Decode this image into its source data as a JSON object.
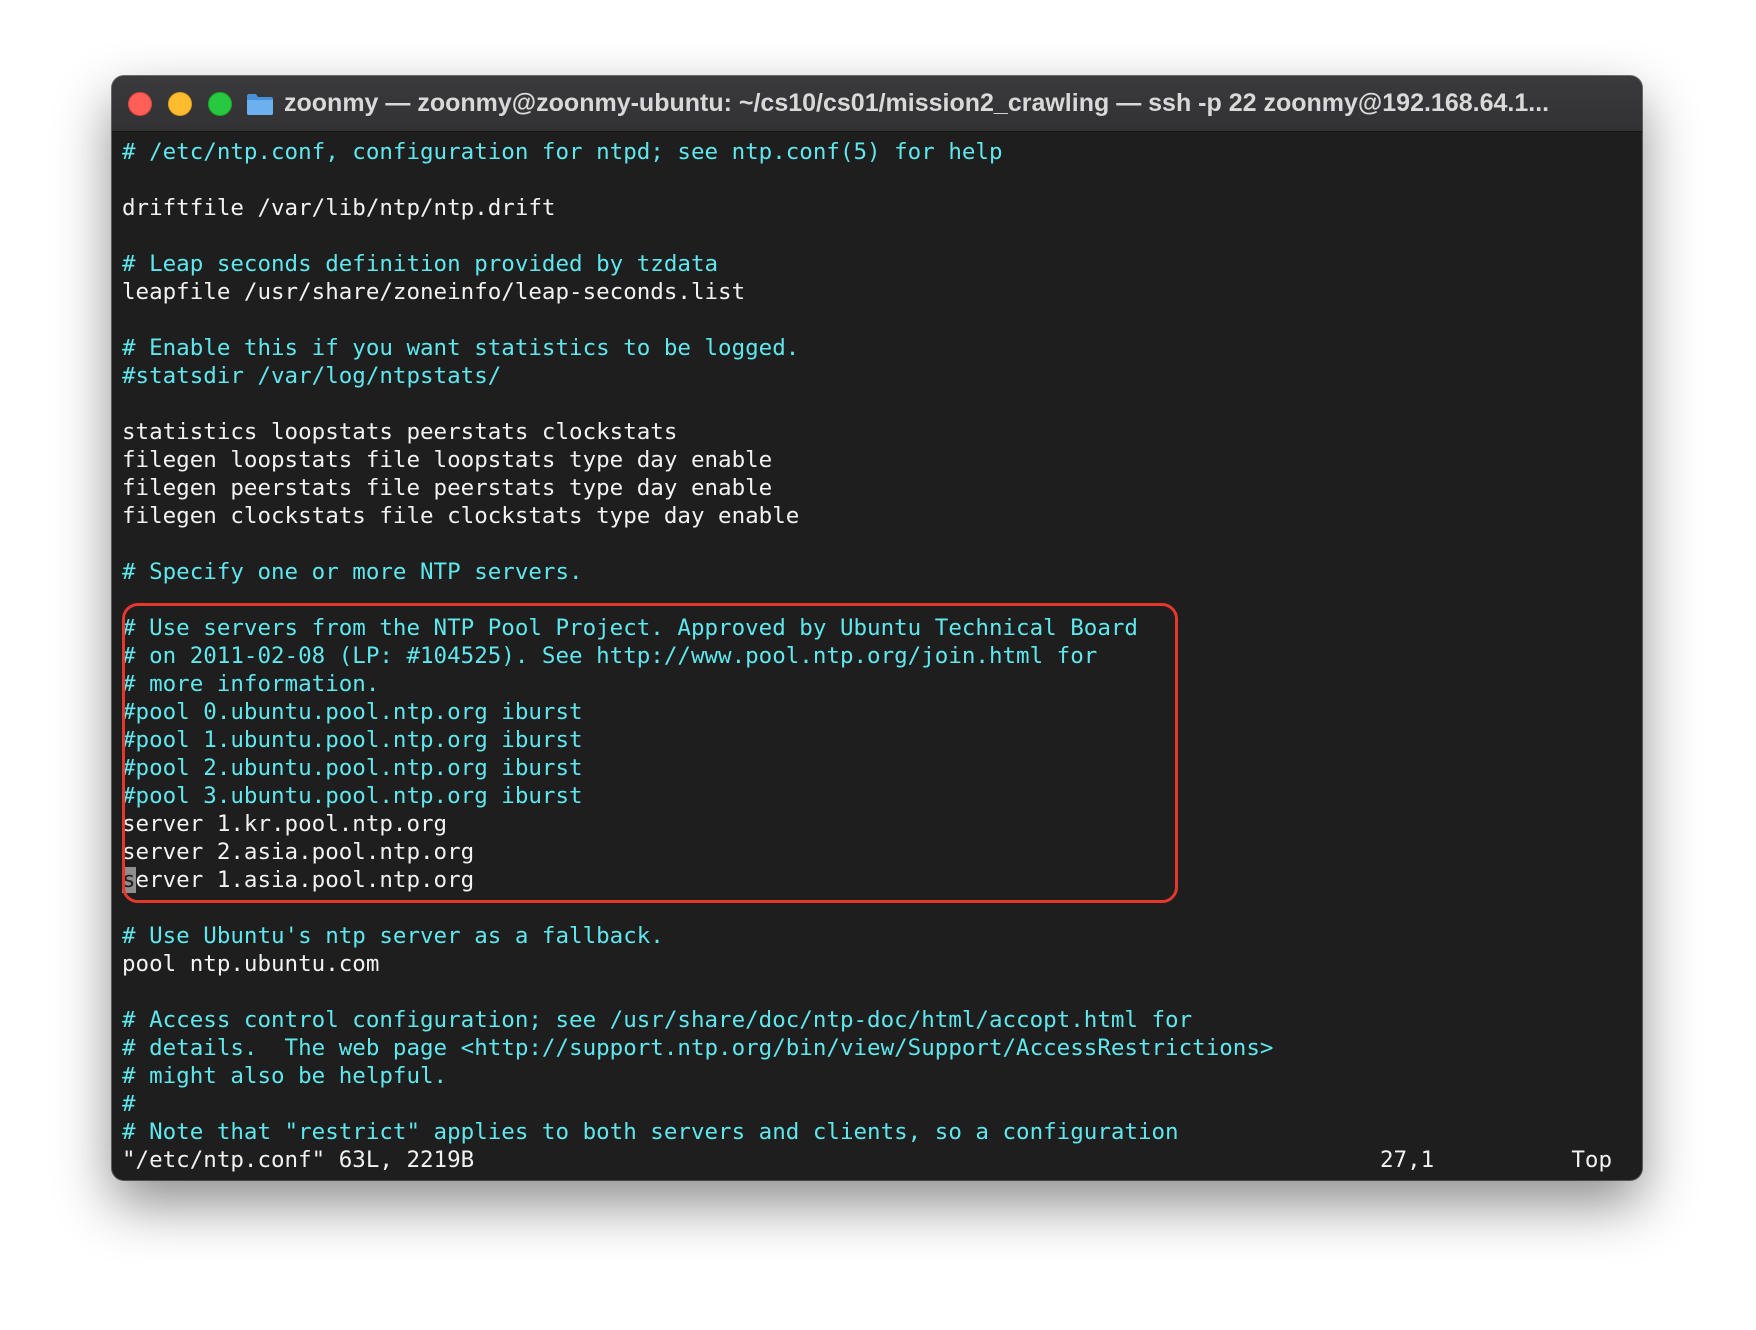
{
  "window": {
    "title": "zoonmy — zoonmy@zoonmy-ubuntu: ~/cs10/cs01/mission2_crawling — ssh -p 22 zoonmy@192.168.64.1...",
    "buttons": {
      "close": "close-button",
      "minimize": "minimize-button",
      "zoom": "zoom-button"
    },
    "icon": "folder-icon"
  },
  "editor": {
    "lines": [
      {
        "text": "# /etc/ntp.conf, configuration for ntpd; see ntp.conf(5) for help",
        "kind": "comment"
      },
      {
        "text": "",
        "kind": "normal"
      },
      {
        "text": "driftfile /var/lib/ntp/ntp.drift",
        "kind": "normal"
      },
      {
        "text": "",
        "kind": "normal"
      },
      {
        "text": "# Leap seconds definition provided by tzdata",
        "kind": "comment"
      },
      {
        "text": "leapfile /usr/share/zoneinfo/leap-seconds.list",
        "kind": "normal"
      },
      {
        "text": "",
        "kind": "normal"
      },
      {
        "text": "# Enable this if you want statistics to be logged.",
        "kind": "comment"
      },
      {
        "text": "#statsdir /var/log/ntpstats/",
        "kind": "comment"
      },
      {
        "text": "",
        "kind": "normal"
      },
      {
        "text": "statistics loopstats peerstats clockstats",
        "kind": "normal"
      },
      {
        "text": "filegen loopstats file loopstats type day enable",
        "kind": "normal"
      },
      {
        "text": "filegen peerstats file peerstats type day enable",
        "kind": "normal"
      },
      {
        "text": "filegen clockstats file clockstats type day enable",
        "kind": "normal"
      },
      {
        "text": "",
        "kind": "normal"
      },
      {
        "text": "# Specify one or more NTP servers.",
        "kind": "comment"
      },
      {
        "text": "",
        "kind": "normal"
      },
      {
        "text": "# Use servers from the NTP Pool Project. Approved by Ubuntu Technical Board",
        "kind": "comment"
      },
      {
        "text": "# on 2011-02-08 (LP: #104525). See http://www.pool.ntp.org/join.html for",
        "kind": "comment"
      },
      {
        "text": "# more information.",
        "kind": "comment"
      },
      {
        "text": "#pool 0.ubuntu.pool.ntp.org iburst",
        "kind": "comment"
      },
      {
        "text": "#pool 1.ubuntu.pool.ntp.org iburst",
        "kind": "comment"
      },
      {
        "text": "#pool 2.ubuntu.pool.ntp.org iburst",
        "kind": "comment"
      },
      {
        "text": "#pool 3.ubuntu.pool.ntp.org iburst",
        "kind": "comment"
      },
      {
        "text": "server 1.kr.pool.ntp.org",
        "kind": "normal"
      },
      {
        "text": "server 2.asia.pool.ntp.org",
        "kind": "normal"
      },
      {
        "text": "server 1.asia.pool.ntp.org",
        "kind": "normal",
        "cursor": true
      },
      {
        "text": "",
        "kind": "normal"
      },
      {
        "text": "# Use Ubuntu's ntp server as a fallback.",
        "kind": "comment"
      },
      {
        "text": "pool ntp.ubuntu.com",
        "kind": "normal"
      },
      {
        "text": "",
        "kind": "normal"
      },
      {
        "text": "# Access control configuration; see /usr/share/doc/ntp-doc/html/accopt.html for",
        "kind": "comment"
      },
      {
        "text": "# details.  The web page <http://support.ntp.org/bin/view/Support/AccessRestrictions>",
        "kind": "comment"
      },
      {
        "text": "# might also be helpful.",
        "kind": "comment"
      },
      {
        "text": "#",
        "kind": "comment"
      },
      {
        "text": "# Note that \"restrict\" applies to both servers and clients, so a configuration",
        "kind": "comment"
      }
    ],
    "highlight_color": "#e5382d",
    "comment_color": "#5ee8ee",
    "text_color": "#f2f2f2"
  },
  "status": {
    "file": "\"/etc/ntp.conf\" 63L, 2219B",
    "position": "27,1",
    "scroll": "Top"
  }
}
